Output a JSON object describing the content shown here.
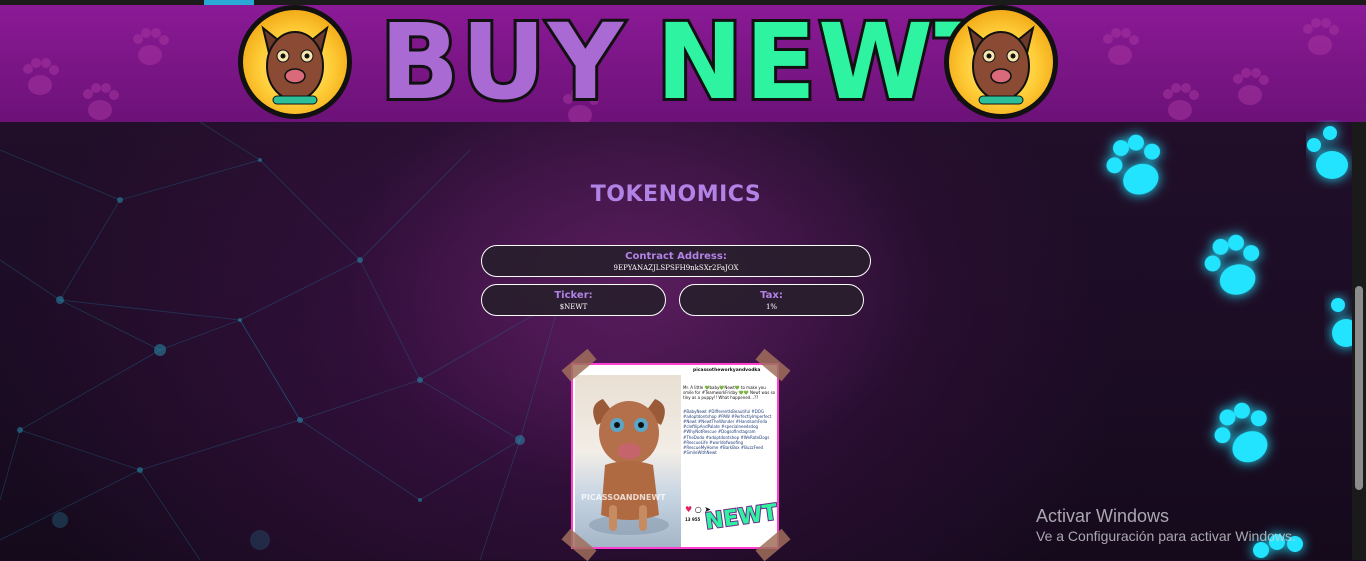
{
  "banner": {
    "title_word_1": "BUY",
    "title_word_2": "NEWT"
  },
  "tokenomics": {
    "title": "TOKENOMICS",
    "contract_label": "Contract Address:",
    "contract_value": "9EPYANAZJLSPSFH9nkSXr2FaJOX",
    "ticker_label": "Ticker:",
    "ticker_value": "$NEWT",
    "tax_label": "Tax:",
    "tax_value": "1%"
  },
  "photo": {
    "watermark": "PICASSOANDNEWT",
    "sticker": "NEWT",
    "ig_user": "picassotheworkyandvodka",
    "ig_caption": "Mr. A little 💚baby💚Newt💚 to make you smile for #TeamworkFriday 💚💚 Newt was so tiny as a puppy!! What happened...??",
    "ig_hashtags": "#BabyNewt #DifferentIsBeautiful #DOG #adoptdontshop #PAW #PerfectlyImperfect #Newt #NewtTheWonder #HandsomFella #cleftlipAndPalate #specialneedsdog #WhyNotRescue #DogsofInstagram #TheDodo #adoptdontshop #WeRateDogs #RescueLife #worldofwoofing #RescueMyHome #BarkBox #BuzzFeed #SmileWithNewt",
    "ig_likes": "13 955"
  },
  "windows_watermark": {
    "line1": "Activar Windows",
    "line2": "Ve a Configuración para activar Windows."
  },
  "colors": {
    "banner": "#7a1585",
    "accent_purple": "#b283e6",
    "accent_green": "#2ef4a2",
    "paw_cyan": "#22e4ff",
    "pill_border": "#ffffff",
    "photo_border": "#ff3fd0"
  },
  "icons": [
    "paw-print-icon",
    "newt-dog-logo-icon",
    "heart-icon",
    "comment-icon",
    "share-icon",
    "bookmark-icon"
  ]
}
